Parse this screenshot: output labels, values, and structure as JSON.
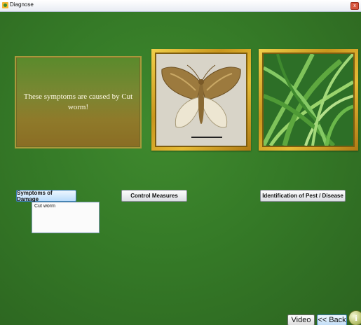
{
  "window": {
    "title": "Diagnose",
    "close_glyph": "x"
  },
  "message": {
    "text": "These symptoms are caused by Cut worm!"
  },
  "images": [
    {
      "subject": "moth photo"
    },
    {
      "subject": "grass photo"
    }
  ],
  "tabs": [
    {
      "label": "Symptoms of Damage",
      "active": true
    },
    {
      "label": "Control Measures",
      "active": false
    },
    {
      "label": "Identification of Pest / Disease",
      "active": false
    }
  ],
  "symptom_list": {
    "items": [
      "Cut worm"
    ]
  },
  "footer": {
    "video_label": "Video",
    "back_label": "<< Back",
    "info_glyph": "i"
  },
  "colors": {
    "background": "#357a27",
    "frame_gold": "#e6bb35",
    "active_tab": "#b9dcfb"
  }
}
